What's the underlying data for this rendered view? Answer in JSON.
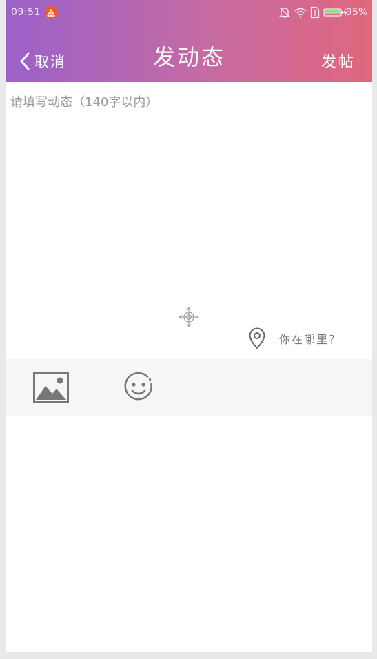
{
  "status_bar": {
    "time": "09:51",
    "battery": "95%"
  },
  "nav": {
    "back_label": "取消",
    "title": "发动态",
    "post_label": "发帖"
  },
  "compose": {
    "placeholder": "请填写动态（140字以内）",
    "value": ""
  },
  "location": {
    "label": "你在哪里？"
  },
  "toolbar": {
    "items": [
      "image-icon",
      "emoji-icon"
    ]
  },
  "colors": {
    "header_gradient_start": "#9b62c9",
    "header_gradient_end": "#e0677d",
    "toolbar_bg": "#f6f6f6",
    "icon_gray": "#777777"
  }
}
